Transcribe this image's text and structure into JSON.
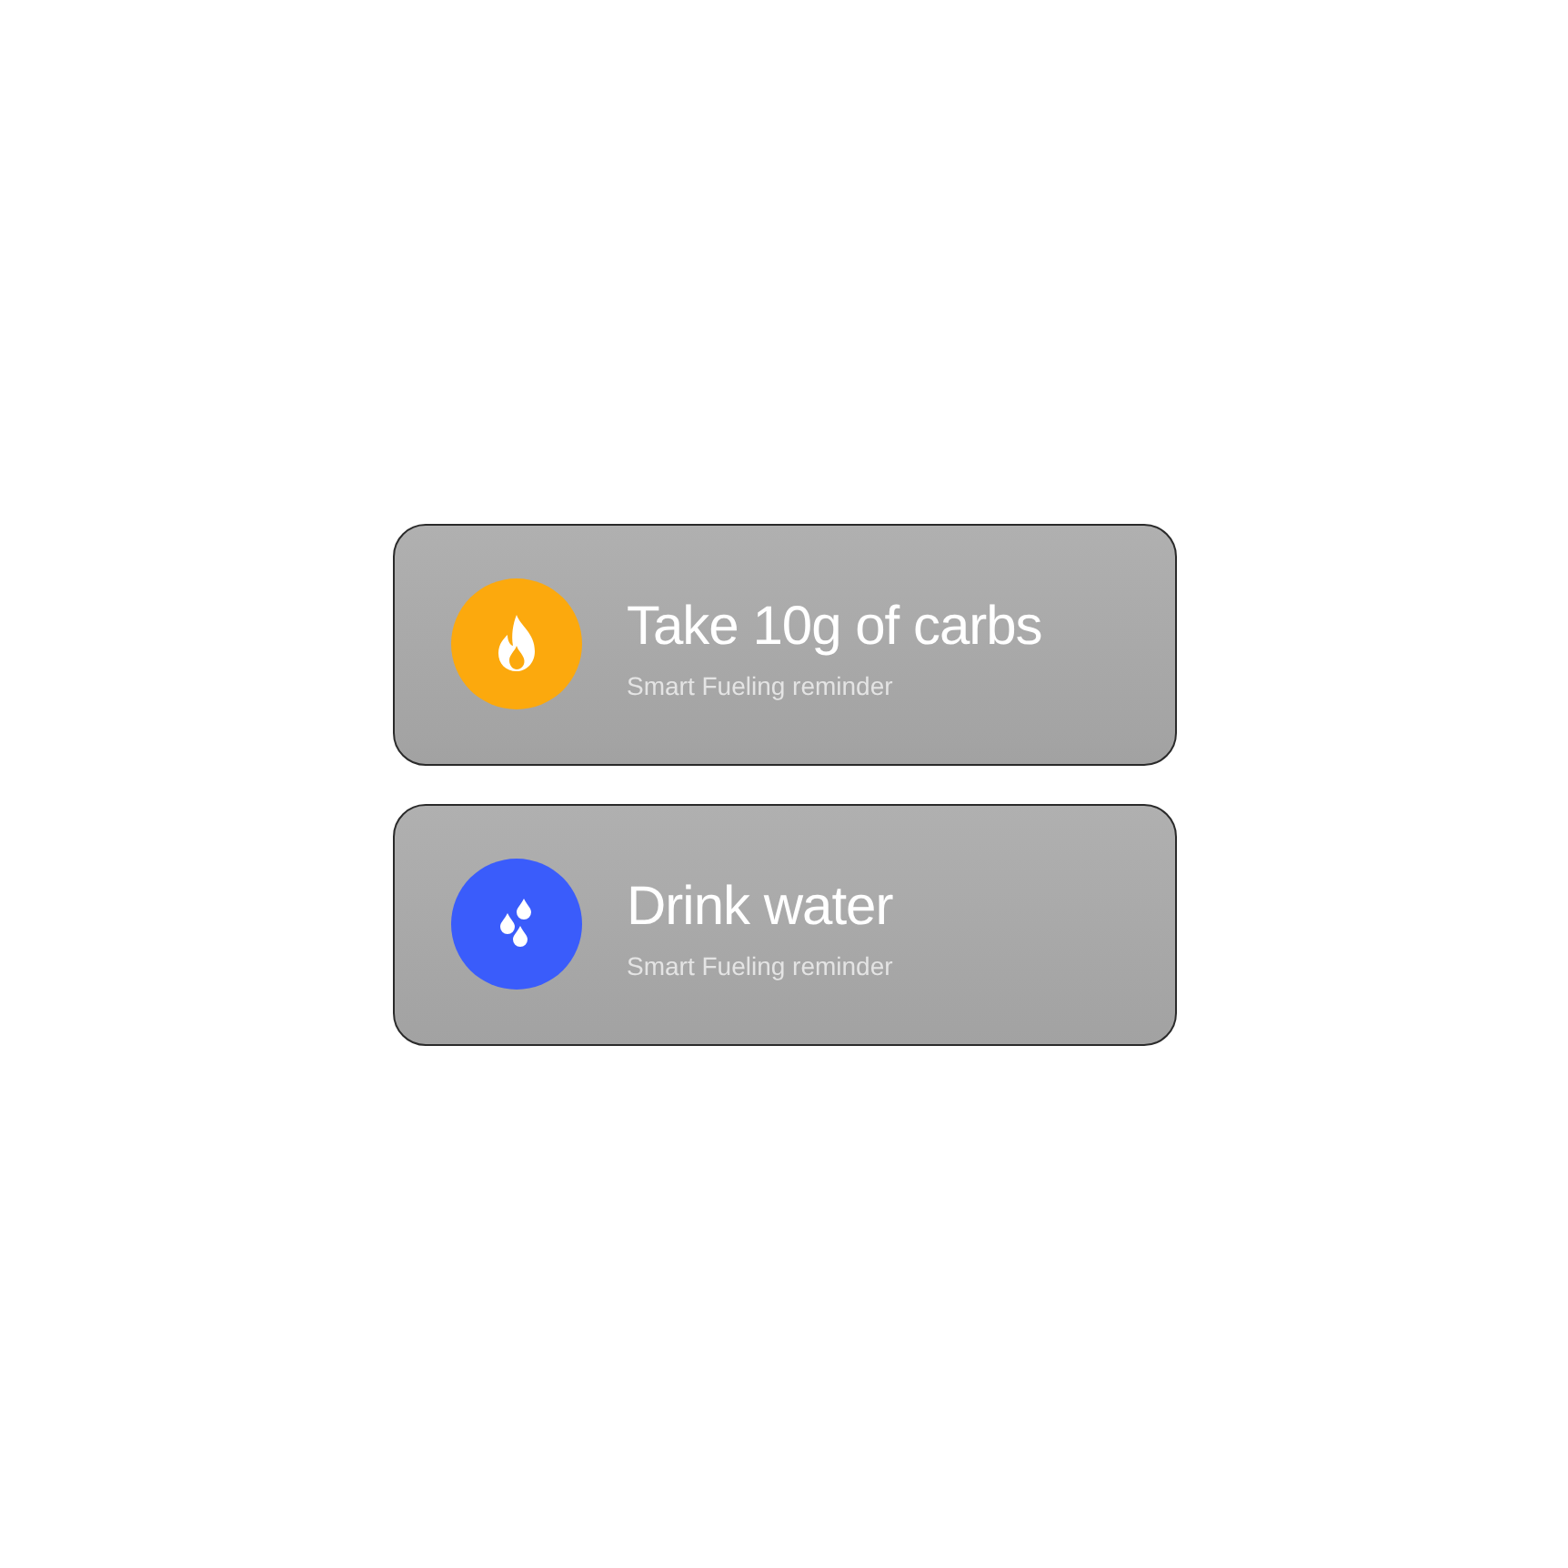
{
  "reminders": [
    {
      "kind": "flame",
      "color": "#fca90d",
      "title": "Take 10g of carbs",
      "subtitle": "Smart Fueling reminder"
    },
    {
      "kind": "drops",
      "color": "#3a5cfb",
      "title": "Drink water",
      "subtitle": "Smart Fueling reminder"
    }
  ]
}
